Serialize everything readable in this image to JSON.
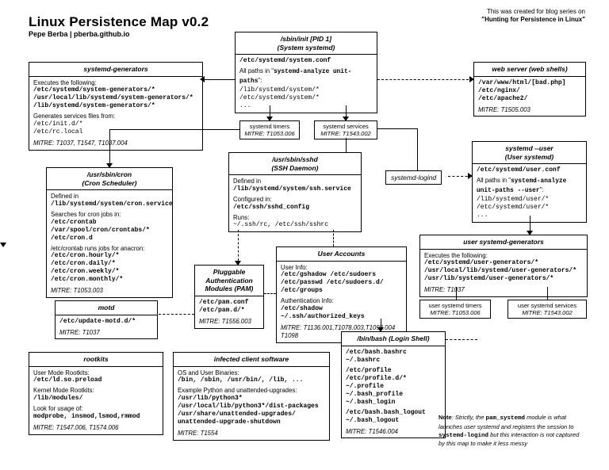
{
  "title": "Linux Persistence Map v0.2",
  "subtitle": "Pepe Berba | pberba.github.io",
  "credit_line1": "This was created for blog series on",
  "credit_line2": "\"Hunting for Persistence in Linux\"",
  "note_html": "Note: Strictly, the pam_systemd module is what launches user systemd and registers the session to systemd-logind but this interaction is not captured by this map to make it less messy",
  "systemd_generators": {
    "header": "systemd-generators",
    "exec_lbl": "Executes the following:",
    "exec_paths": "/etc/systemd/system-generators/*\n/usr/local/lib/systemd/system-generators/*\n/lib/systemd/system-generators/*",
    "gen_lbl": "Generates services files from:",
    "gen_paths": "/etc/init.d/*\n/etc/rc.local",
    "mitre": "MITRE: T1037, T1547, T1037.004"
  },
  "init": {
    "header": "/sbin/init [PID 1]\n(System systemd)",
    "conf": "/etc/systemd/system.conf",
    "unit_lbl": "All paths in \"systemd-analyze unit-paths\":",
    "unit_paths": "/lib/systemd/system/*\n/etc/systemd/system/*\n..."
  },
  "web": {
    "header": "web server (web shells)",
    "paths": "/var/www/html/[bad.php]\n/etc/nginx/\n/etc/apache2/",
    "mitre": "MITRE: T1505.003"
  },
  "timers_chip": {
    "t": "systemd timers",
    "m": "MITRE: T1053.006"
  },
  "services_chip": {
    "t": "systemd services",
    "m": "MITRE: T1543.002"
  },
  "logind_label": "systemd-logind",
  "systemd_user": {
    "header": "systemd --user\n(User systemd)",
    "conf": "/etc/systemd/user.conf",
    "unit_lbl": "All paths in \"systemd-analyze unit-paths --user\":",
    "unit_paths": "/lib/systemd/user/*\n/etc/systemd/user/*\n..."
  },
  "cron": {
    "header": "/usr/sbin/cron\n(Cron Scheduler)",
    "def_lbl": "Defined in",
    "def_path": "/lib/systemd/system/cron.service",
    "search_lbl": "Searches for cron jobs in:",
    "search_paths": "/etc/crontab\n/var/spool/cron/crontabs/*\n/etc/cron.d",
    "anacron_lbl": "/etc/crontab runs jobs for anacron:",
    "anacron_paths": "/etc/cron.hourly/*\n/etc/cron.daily/*\n/etc/cron.weekly/*\n/etc/cron.monthly/*",
    "mitre": "MITRE: T1053.003"
  },
  "sshd": {
    "header": "/usr/sbin/sshd\n(SSH Daemon)",
    "def_lbl": "Defined in",
    "def_path": "/lib/systemd/system/ssh.service",
    "cfg_lbl": "Configured in:",
    "cfg_path": "/etc/ssh/sshd_config",
    "runs_lbl": "Runs:",
    "runs_path": "~/.ssh/rc, /etc/ssh/sshrc"
  },
  "pam": {
    "header": "Pluggable\nAuthentication\nModules (PAM)",
    "paths": "/etc/pam.conf\n/etc/pam.d/*",
    "mitre": "MITRE: T1556.003"
  },
  "accounts": {
    "header": "User Accounts",
    "ui_lbl": "User Info:",
    "ui_paths": "/etc/gshadow /etc/sudoers\n/etc/passwd /etc/sudoers.d/\n/etc/groups",
    "auth_lbl": "Authentication Info:",
    "auth_paths": "/etc/shadow\n~/.ssh/authorized_keys",
    "mitre": "MITRE: T1136.001,T1078.003,T1098.004 T1098"
  },
  "motd": {
    "header": "motd",
    "paths": "/etc/update-motd.d/*",
    "mitre": "MITRE: T1037"
  },
  "user_gen": {
    "header": "user systemd-generators",
    "exec_lbl": "Executes the following:",
    "exec_paths": "/etc/systemd/user-generators/*\n/usr/local/lib/systemd/user-generators/*\n/usr/lib/systemd/user-generators/*",
    "mitre": "MITRE: T1037"
  },
  "user_timers_chip": {
    "t": "user systemd timers",
    "m": "MITRE: T1053.006"
  },
  "user_services_chip": {
    "t": "user systemd services",
    "m": "MITRE: T1543.002"
  },
  "bash": {
    "header": "/bin/bash (Login Shell)",
    "p1": "/etc/bash.bashrc\n~/.bashrc",
    "p2": "/etc/profile\n/etc/profile.d/*\n~/.profile\n~/.bash_profile\n~/.bash_login",
    "p3": "/etc/bash.bash_logout\n~/.bash_logout",
    "mitre": "MITRE: T1546.004"
  },
  "rootkits": {
    "header": "rootkits",
    "u_lbl": "User Mode Rootkits:",
    "u_path": "/etc/ld.so.preload",
    "k_lbl": "Kernel Mode Rootkits:",
    "k_path": "/lib/modules/",
    "look_lbl": "Look for usage of:",
    "look_path": "modprobe, insmod,lsmod,rmmod",
    "mitre": "MITRE: T1547.006, T1574.006"
  },
  "infected": {
    "header": "infected client software",
    "os_lbl": "OS and User Binaries:",
    "os_path": "/bin, /sbin, /usr/bin/, /lib, ...",
    "ex_lbl": "Example Python and unattended-upgrades:",
    "ex_path": "/usr/lib/python3*\n/usr/local/lib/python3*/dist-packages\n/usr/share/unattended-upgrades/\nunattended-upgrade-shutdown",
    "mitre": "MITRE: T1554"
  }
}
